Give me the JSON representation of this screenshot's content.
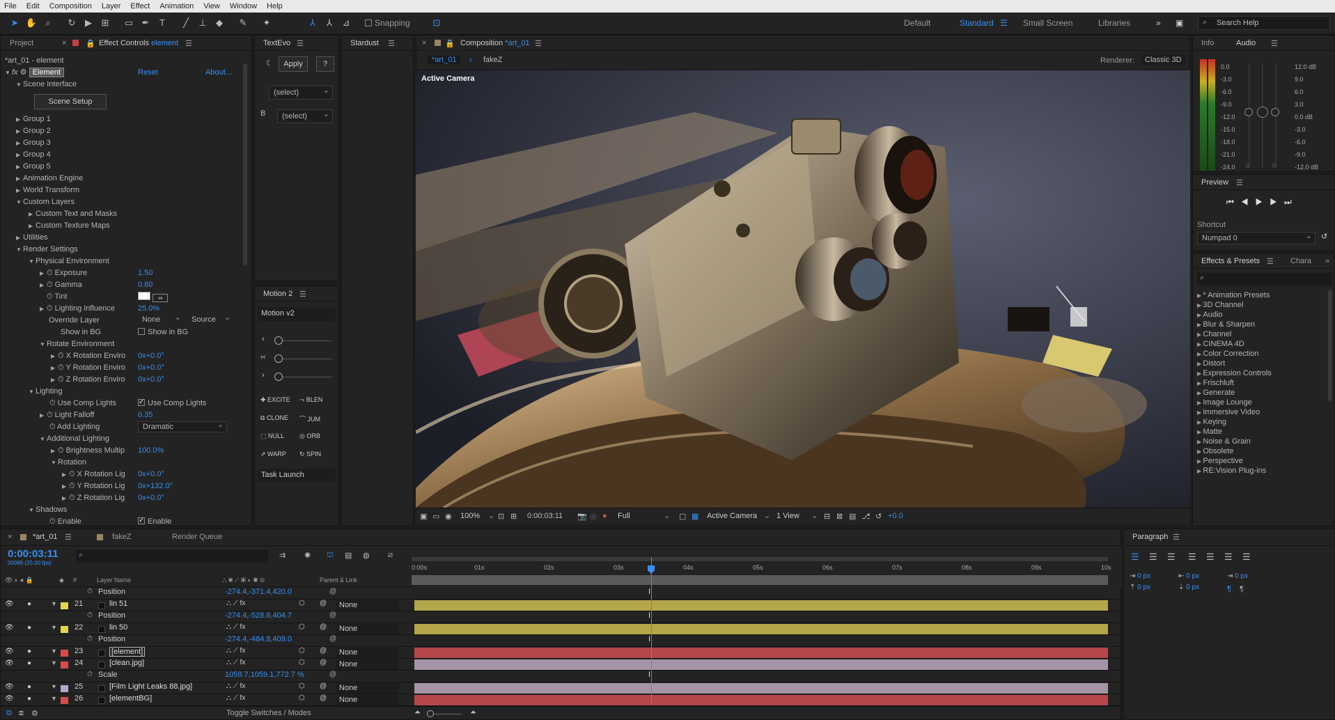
{
  "menu": [
    "File",
    "Edit",
    "Composition",
    "Layer",
    "Effect",
    "Animation",
    "View",
    "Window",
    "Help"
  ],
  "toolbar": {
    "snapping": "Snapping",
    "workspaces": [
      "Default",
      "Standard",
      "Small Screen",
      "Libraries"
    ],
    "search_help": "Search Help"
  },
  "project_panel": {
    "tab_project": "Project",
    "tab_effect_controls": "Effect Controls",
    "effect_target": "element",
    "title": "*art_01 - element",
    "effect_name": "Element",
    "reset": "Reset",
    "about": "About...",
    "scene_interface": "Scene Interface",
    "scene_setup": "Scene Setup",
    "groups": [
      "Group 1",
      "Group 2",
      "Group 3",
      "Group 4",
      "Group 5"
    ],
    "items": [
      "Animation Engine",
      "World Transform",
      "Custom Layers",
      "Custom Text and Masks",
      "Custom Texture Maps",
      "Utilities",
      "Render Settings",
      "Physical Environment"
    ],
    "exposure": {
      "label": "Exposure",
      "value": "1.50"
    },
    "gamma": {
      "label": "Gamma",
      "value": "0.80"
    },
    "tint": {
      "label": "Tint"
    },
    "lighting_influence": {
      "label": "Lighting Influence",
      "value": "25.0%"
    },
    "override_layer": {
      "label": "Override Layer",
      "v1": "None",
      "v2": "Source"
    },
    "show_in_bg": {
      "label": "Show in BG",
      "check": "Show in BG"
    },
    "rotate_env": "Rotate Environment",
    "xrot": {
      "label": "X Rotation Enviro",
      "value": "0x+0.0°"
    },
    "yrot": {
      "label": "Y Rotation Enviro",
      "value": "0x+0.0°"
    },
    "zrot": {
      "label": "Z Rotation Enviro",
      "value": "0x+0.0°"
    },
    "lighting": "Lighting",
    "use_comp_lights": {
      "label": "Use Comp Lights",
      "check": "Use Comp Lights"
    },
    "light_falloff": {
      "label": "Light Falloff",
      "value": "0.35"
    },
    "add_lighting": {
      "label": "Add Lighting",
      "value": "Dramatic"
    },
    "additional_lighting": "Additional Lighting",
    "brightness": {
      "label": "Brightness Multip",
      "value": "100.0%"
    },
    "rotation": "Rotation",
    "xrl": {
      "label": "X Rotation Lig",
      "value": "0x+0.0°"
    },
    "yrl": {
      "label": "Y Rotation Lig",
      "value": "0x+132.0°"
    },
    "zrl": {
      "label": "Z Rotation Lig",
      "value": "0x+0.0°"
    },
    "shadows": "Shadows",
    "enable": {
      "label": "Enable",
      "check": "Enable"
    }
  },
  "textevo": {
    "title": "TextEvo",
    "apply": "Apply",
    "help": "?",
    "select1": "(select)",
    "b_label": "B",
    "select2": "(select)"
  },
  "stardust": {
    "title": "Stardust"
  },
  "motion": {
    "title": "Motion 2",
    "version": "Motion v2",
    "buttons": [
      [
        "EXCITE",
        "BLEN"
      ],
      [
        "CLONE",
        "JUM"
      ],
      [
        "NULL",
        "ORB"
      ],
      [
        "WARP",
        "SPIN"
      ]
    ],
    "task_launch": "Task Launch"
  },
  "composition": {
    "tab_label": "Composition",
    "comp_name": "*art_01",
    "breadcrumb1": "*art_01",
    "breadcrumb2": "fakeZ",
    "renderer_label": "Renderer:",
    "renderer_value": "Classic 3D",
    "active_camera_label": "Active Camera",
    "zoom": "100%",
    "timecode": "0:00:03:11",
    "resolution": "Full",
    "camera": "Active Camera",
    "view": "1 View",
    "exposure": "+0.0"
  },
  "info_panel": {
    "tab_info": "Info",
    "tab_audio": "Audio",
    "db_left": [
      "0.0",
      "-3.0",
      "-6.0",
      "-9.0",
      "-12.0",
      "-15.0",
      "-18.0",
      "-21.0",
      "-24.0"
    ],
    "db_right": [
      "12.0 dB",
      "9.0",
      "6.0",
      "3.0",
      "0.0 dB",
      "-3.0",
      "-6.0",
      "-9.0",
      "-12.0 dB"
    ],
    "zero_a": "0",
    "zero_b": "0"
  },
  "preview": {
    "title": "Preview",
    "shortcut_label": "Shortcut",
    "shortcut_value": "Numpad 0"
  },
  "effects_presets": {
    "title": "Effects & Presets",
    "tab2": "Chara",
    "list": [
      "* Animation Presets",
      "3D Channel",
      "Audio",
      "Blur & Sharpen",
      "Channel",
      "CINEMA 4D",
      "Color Correction",
      "Distort",
      "Expression Controls",
      "Frischluft",
      "Generate",
      "Image Lounge",
      "Immersive Video",
      "Keying",
      "Matte",
      "Noise & Grain",
      "Obsolete",
      "Perspective",
      "RE:Vision Plug-ins"
    ]
  },
  "timeline": {
    "tab_comp": "*art_01",
    "tab_fakez": "fakeZ",
    "tab_render": "Render Queue",
    "timecode": "0:00:03:11",
    "frames": "00086 (25.00 fps)",
    "col_num": "#",
    "col_layer": "Layer Name",
    "col_parent": "Parent & Link",
    "ruler": [
      "0:00s",
      "01s",
      "02s",
      "03s",
      "04s",
      "05s",
      "06s",
      "07s",
      "08s",
      "09s",
      "10s"
    ],
    "rows": [
      {
        "type": "prop",
        "name": "Position",
        "value": "-274.4,-371.4,420.0"
      },
      {
        "type": "layer",
        "num": "21",
        "name": "lin 51",
        "parent": "None",
        "label_color": "#e6d44a",
        "bar": "#b3a549"
      },
      {
        "type": "prop",
        "name": "Position",
        "value": "-274.4,-528.6,404.7"
      },
      {
        "type": "layer",
        "num": "22",
        "name": "lin 50",
        "parent": "None",
        "label_color": "#e6d44a",
        "bar": "#b3a549"
      },
      {
        "type": "prop",
        "name": "Position",
        "value": "-274.4,-484.8,409.0"
      },
      {
        "type": "layer",
        "num": "23",
        "name": "[element]",
        "parent": "None",
        "label_color": "#d94b4b",
        "bar": "#b5474a"
      },
      {
        "type": "layer",
        "num": "24",
        "name": "[clean.jpg]",
        "parent": "None",
        "label_color": "#d94b4b",
        "bar": "#a594a6"
      },
      {
        "type": "prop",
        "name": "Scale",
        "value": "1059.7,1059.1,772.7 %"
      },
      {
        "type": "layer",
        "num": "25",
        "name": "[Film Light Leaks 88.jpg]",
        "parent": "None",
        "label_color": "#b8a5c8",
        "bar": "#a594a6"
      },
      {
        "type": "layer",
        "num": "26",
        "name": "[elementBG]",
        "parent": "None",
        "label_color": "#d94b4b",
        "bar": "#b5474a"
      }
    ],
    "toggle": "Toggle Switches / Modes",
    "playhead_seconds": 3.44
  },
  "paragraph": {
    "title": "Paragraph",
    "v1": "0 px",
    "v2": "0 px",
    "v3": "0 px",
    "v4": "0 px",
    "v5": "0 px"
  },
  "colors": {
    "accent": "#3a8ff0",
    "bg": "#232323"
  }
}
